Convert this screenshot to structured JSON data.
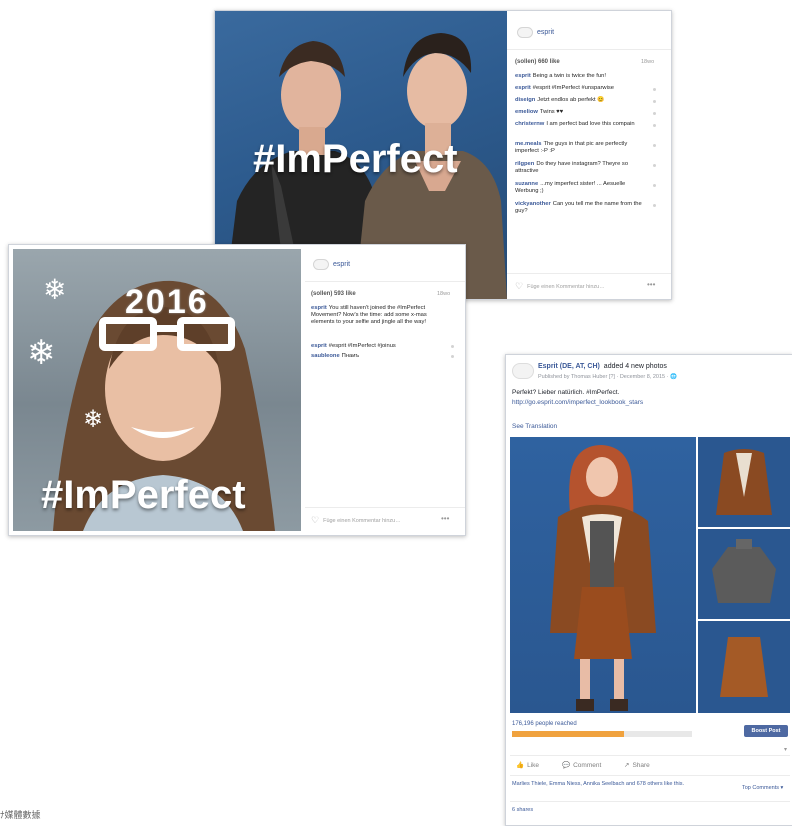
{
  "colors": {
    "blue_backdrop": "#2d5b8e",
    "facebook_blue": "#3b5998",
    "reach_bar": "#f0a23e",
    "boost_button": "#4e69a2"
  },
  "post_top": {
    "hashtag": "#ImPerfect",
    "account": "esprit",
    "likes": "(sollen) 660 like",
    "age": "18wo",
    "comments": [
      {
        "user": "esprit",
        "text": "Being a twin is twice the fun!"
      },
      {
        "user": "esprit",
        "text": "#esprit #ImPerfect #unsparwise"
      },
      {
        "user": "diseign",
        "text": "Jetzt endlos ab perfekt 😊"
      },
      {
        "user": "emeliow",
        "text": "Twins ♥♥"
      },
      {
        "user": "christernw",
        "text": "I am perfect bad love this compain"
      },
      {
        "user": "me.meals",
        "text": "The guys in that pic are perfectly imperfect :-P :P"
      },
      {
        "user": "rilgpen",
        "text": "Do they have instagram? Theyre so attractive"
      },
      {
        "user": "suzanne",
        "text": "...my imperfect sister! ... Aesuelle Werbung ;)"
      },
      {
        "user": "vickyanother",
        "text": "Can you tell me the name from the guy?"
      }
    ],
    "add_comment": "Füge einen Kommentar hinzu…",
    "more": "•••"
  },
  "post_left": {
    "hashtag": "#ImPerfect",
    "year": "2016",
    "account": "esprit",
    "likes": "(sollen) 593 like",
    "age": "18wo",
    "comments": [
      {
        "user": "esprit",
        "text": "You still haven't joined the #ImPerfect Movement? Now's the time: add some x-mas elements to your selfie and jingle all the way!"
      },
      {
        "user": "esprit",
        "text": "#esprit #ImPerfect #joinus"
      },
      {
        "user": "saubleone",
        "text": "Пнаиъ"
      }
    ],
    "add_comment": "Füge einen Kommentar hinzu…",
    "more": "•••"
  },
  "post_fb": {
    "page_name": "Esprit (DE, AT, CH)",
    "action_text": "added 4 new photos",
    "meta": "Published by Thomas Huber [?] · December 8, 2015 · 🌐",
    "text": "Perfekt? Lieber natürlich. #ImPerfect.",
    "link": "http://go.esprit.com/imperfect_lookbook_stars",
    "see_translation": "See Translation",
    "reach": "176,196 people reached",
    "reach_fraction": 0.62,
    "boost": "Boost Post",
    "like": "Like",
    "comment": "Comment",
    "share": "Share",
    "likers": "Marlies Thiele, Emma Niess, Annika Seelbach and 678 others like this.",
    "top_comments": "Top Comments ▾",
    "shares": "6 shares"
  },
  "footer_caption": "ﾅ媒體數據"
}
